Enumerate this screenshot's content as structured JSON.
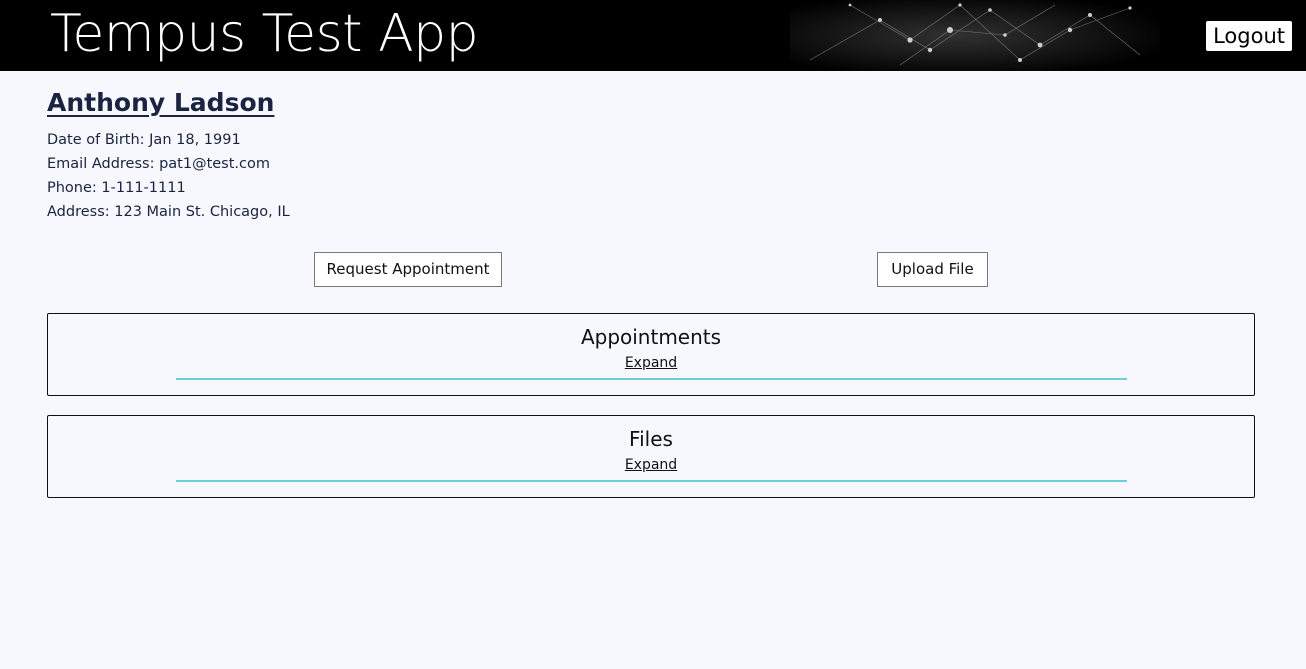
{
  "header": {
    "app_title": "Tempus Test App",
    "logout_label": "Logout",
    "background_color": "#000000"
  },
  "patient": {
    "name": "Anthony Ladson",
    "dob_line": "Date of Birth: Jan 18, 1991",
    "email_line": "Email Address: pat1@test.com",
    "phone_line": "Phone: 1-111-1111",
    "address_line": "Address: 123 Main St. Chicago, IL"
  },
  "actions": {
    "request_label": "Request Appointment",
    "upload_label": "Upload File"
  },
  "panels": [
    {
      "title": "Appointments",
      "expand_label": "Expand"
    },
    {
      "title": "Files",
      "expand_label": "Expand"
    }
  ],
  "colors": {
    "page_background": "#f7f8fd",
    "text": "#1a2340",
    "divider_accent": "#6fcfd6"
  }
}
